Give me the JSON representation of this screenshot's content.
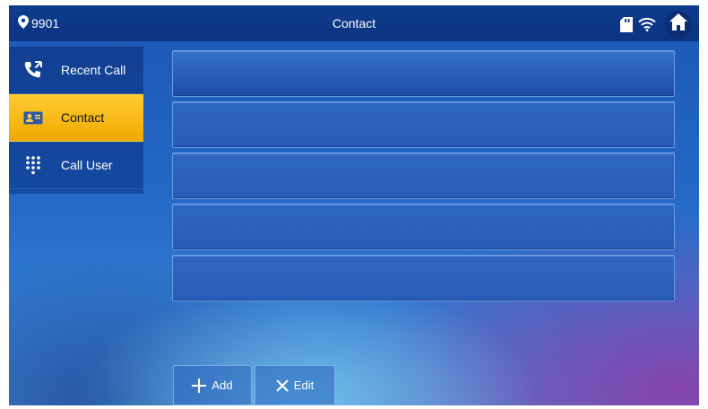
{
  "topbar": {
    "location": "9901",
    "title": "Contact",
    "icons": [
      "location-pin-icon",
      "sd-card-icon",
      "wifi-icon",
      "home-icon"
    ]
  },
  "sidebar": {
    "items": [
      {
        "label": "Recent Call",
        "icon": "recent-call-icon",
        "active": false
      },
      {
        "label": "Contact",
        "icon": "contact-card-icon",
        "active": true
      },
      {
        "label": "Call User",
        "icon": "dialpad-icon",
        "active": false
      }
    ]
  },
  "contacts": {
    "rows": [
      "",
      "",
      "",
      "",
      ""
    ]
  },
  "actions": {
    "add_label": "Add",
    "edit_label": "Edit"
  },
  "colors": {
    "accent": "#f5b400",
    "topbar": "#0e3d8e",
    "background": "#2467c6"
  }
}
